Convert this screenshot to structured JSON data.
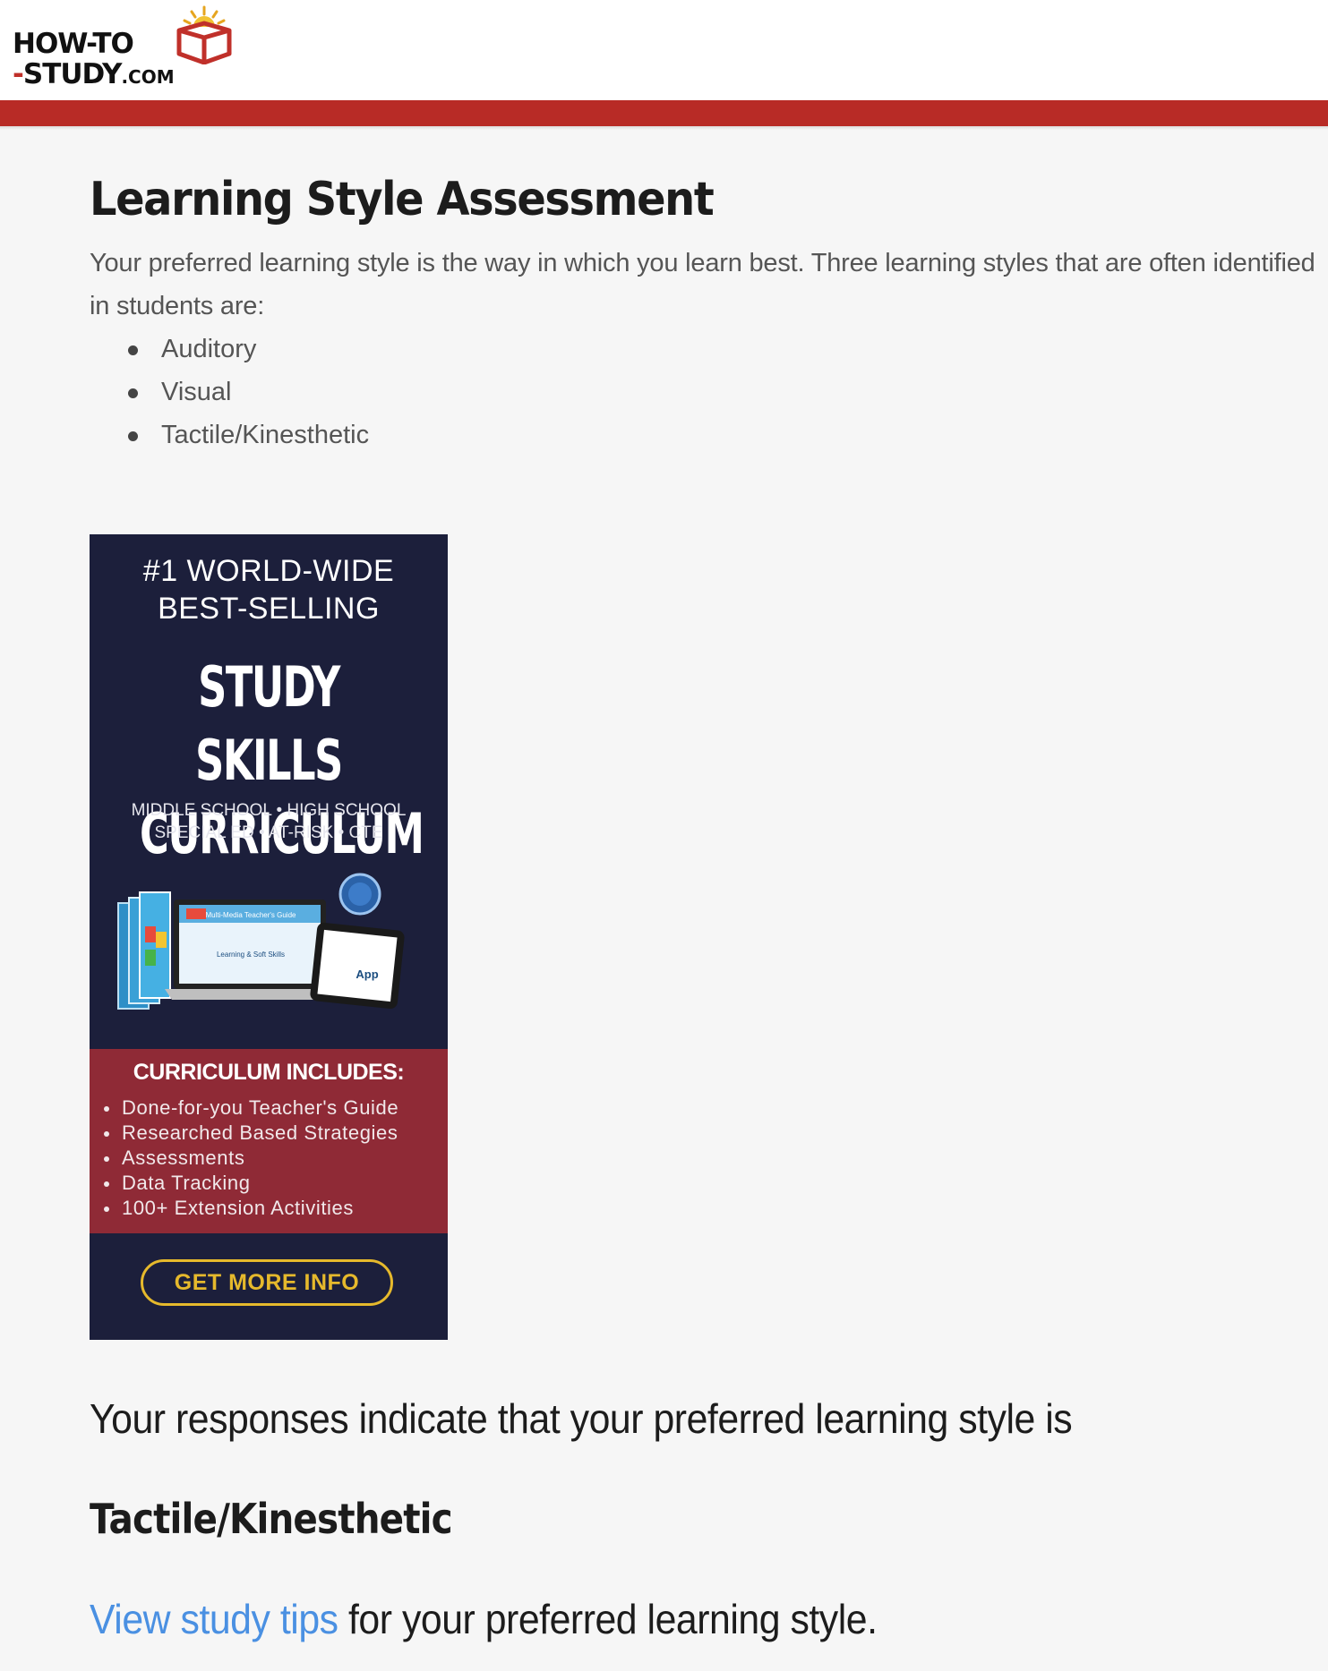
{
  "site": {
    "logo_line1": "HOW-TO",
    "logo_line2_dash": "-",
    "logo_line2": "STUDY",
    "logo_dotcom": ".COM",
    "brand_color": "#b82b26"
  },
  "main": {
    "title": "Learning Style Assessment",
    "intro": "Your preferred learning style is the way in which you learn best. Three learning styles that are often identified in students are:",
    "styles": [
      "Auditory",
      "Visual",
      "Tactile/Kinesthetic"
    ]
  },
  "ad": {
    "top_line1": "#1 WORLD-WIDE",
    "top_line2": "BEST-SELLING",
    "title_line1": "STUDY SKILLS",
    "title_line2": "CURRICULUM",
    "levels_line1": "MIDDLE SCHOOL • HIGH SCHOOL",
    "levels_line2": "SPECIAL ED • AT-RISK • CTE",
    "product_label_1": "Multi-Media Teacher's Guide",
    "product_label_2": "Learning & Soft Skills",
    "product_label_3": "App",
    "includes_title": "CURRICULUM INCLUDES:",
    "includes": [
      "Done-for-you Teacher's Guide",
      "Researched Based Strategies",
      "Assessments",
      "Data Tracking",
      "100+ Extension Activities"
    ],
    "button_label": "GET MORE INFO",
    "colors": {
      "navy": "#1c1f3b",
      "maroon": "#8f2a36",
      "gold": "#e6b92c"
    }
  },
  "result": {
    "lead": "Your responses indicate that your preferred learning style is",
    "style": "Tactile/Kinesthetic",
    "link_text": "View study tips",
    "tail": " for your preferred learning style.",
    "link_color": "#4a90e2"
  }
}
